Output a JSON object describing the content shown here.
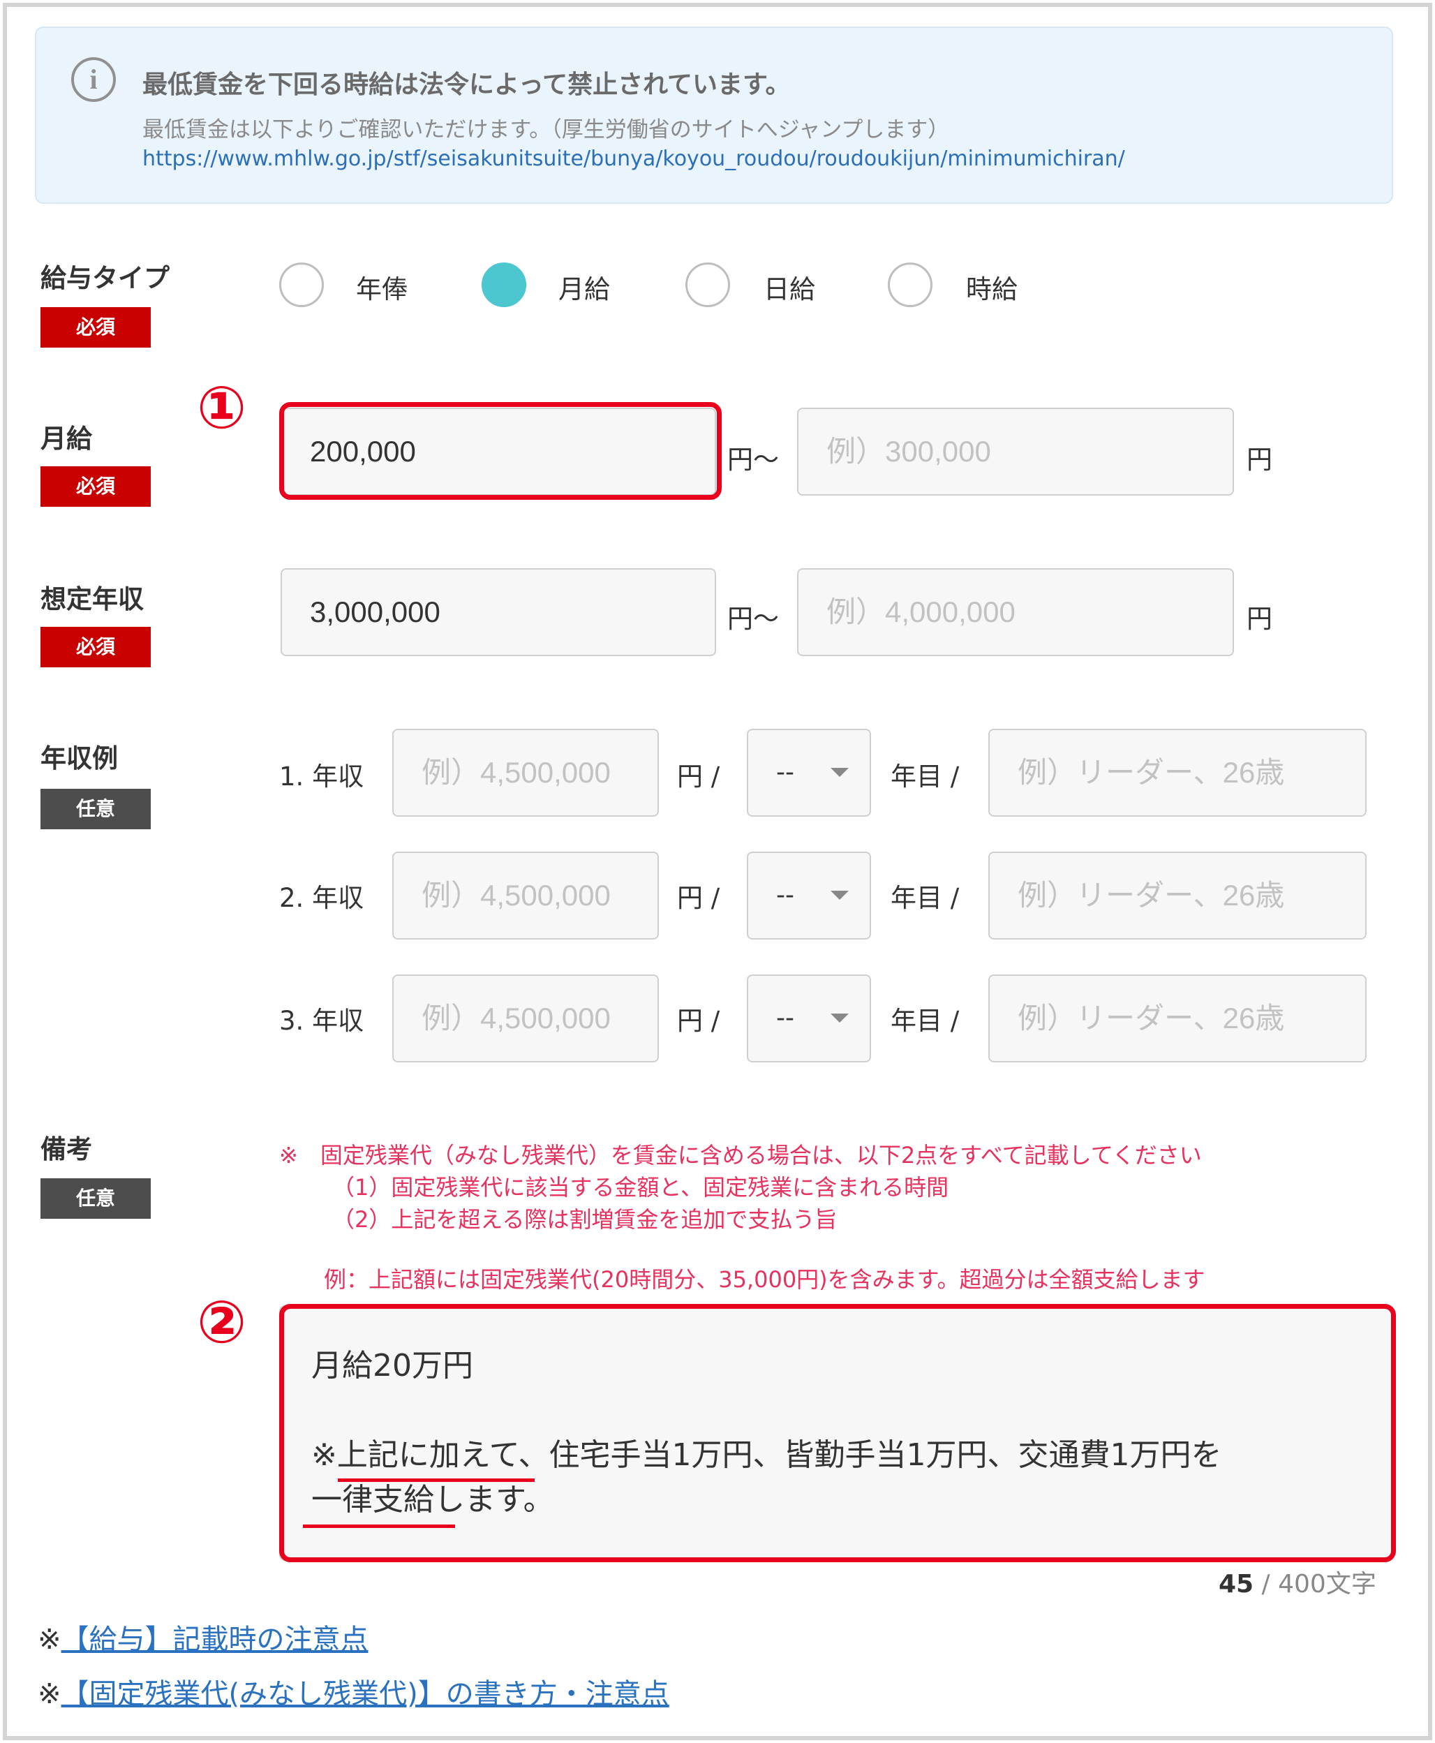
{
  "notice": {
    "title": "最低賃金を下回る時給は法令によって禁止されています。",
    "text": "最低賃金は以下よりご確認いただけます。（厚生労働省のサイトへジャンプします）",
    "url": "https://www.mhlw.go.jp/stf/seisakunitsuite/bunya/koyou_roudou/roudoukijun/minimumichiran/"
  },
  "salary_type": {
    "label": "給与タイプ",
    "badge": "必須",
    "options": [
      "年俸",
      "月給",
      "日給",
      "時給"
    ],
    "selected": "月給"
  },
  "monthly": {
    "label": "月給",
    "badge": "必須",
    "min_value": "200,000",
    "sep": "円〜",
    "max_placeholder": "例）300,000",
    "unit": "円"
  },
  "annual": {
    "label": "想定年収",
    "badge": "必須",
    "min_value": "3,000,000",
    "sep": "円〜",
    "max_placeholder": "例）4,000,000",
    "unit": "円"
  },
  "examples": {
    "label": "年収例",
    "badge": "任意",
    "rows": [
      {
        "label": "1. 年収",
        "amount_placeholder": "例）4,500,000",
        "unit": "円 /",
        "select": "--",
        "year_unit": "年目 /",
        "note_placeholder": "例）リーダー、26歳"
      },
      {
        "label": "2. 年収",
        "amount_placeholder": "例）4,500,000",
        "unit": "円 /",
        "select": "--",
        "year_unit": "年目 /",
        "note_placeholder": "例）リーダー、26歳"
      },
      {
        "label": "3. 年収",
        "amount_placeholder": "例）4,500,000",
        "unit": "円 /",
        "select": "--",
        "year_unit": "年目 /",
        "note_placeholder": "例）リーダー、26歳"
      }
    ]
  },
  "remarks": {
    "label": "備考",
    "badge": "任意",
    "notes": [
      "※　固定残業代（みなし残業代）を賃金に含める場合は、以下2点をすべて記載してください",
      "（1）固定残業代に該当する金額と、固定残業に含まれる時間",
      "（2）上記を超える際は割増賃金を追加で支払う旨"
    ],
    "example": "例：上記額には固定残業代(20時間分、35,000円)を含みます。超過分は全額支給します",
    "text_lines": [
      "月給20万円",
      "※上記に加えて、住宅手当1万円、皆勤手当1万円、交通費1万円を",
      "一律支給します。"
    ],
    "count": "45",
    "limit": " / 400文字"
  },
  "annotations": {
    "marker1": "①",
    "marker2": "②",
    "color": "#e8001c"
  },
  "footer_links": [
    {
      "prefix": "※",
      "text": "【給与】記載時の注意点"
    },
    {
      "prefix": "※",
      "text": "【固定残業代(みなし残業代)】の書き方・注意点"
    }
  ],
  "colors": {
    "required": "#c80000",
    "optional": "#4d4d4d",
    "radio_selected": "#4cc7cf",
    "note": "#e5325e",
    "link": "#2a72bf"
  }
}
